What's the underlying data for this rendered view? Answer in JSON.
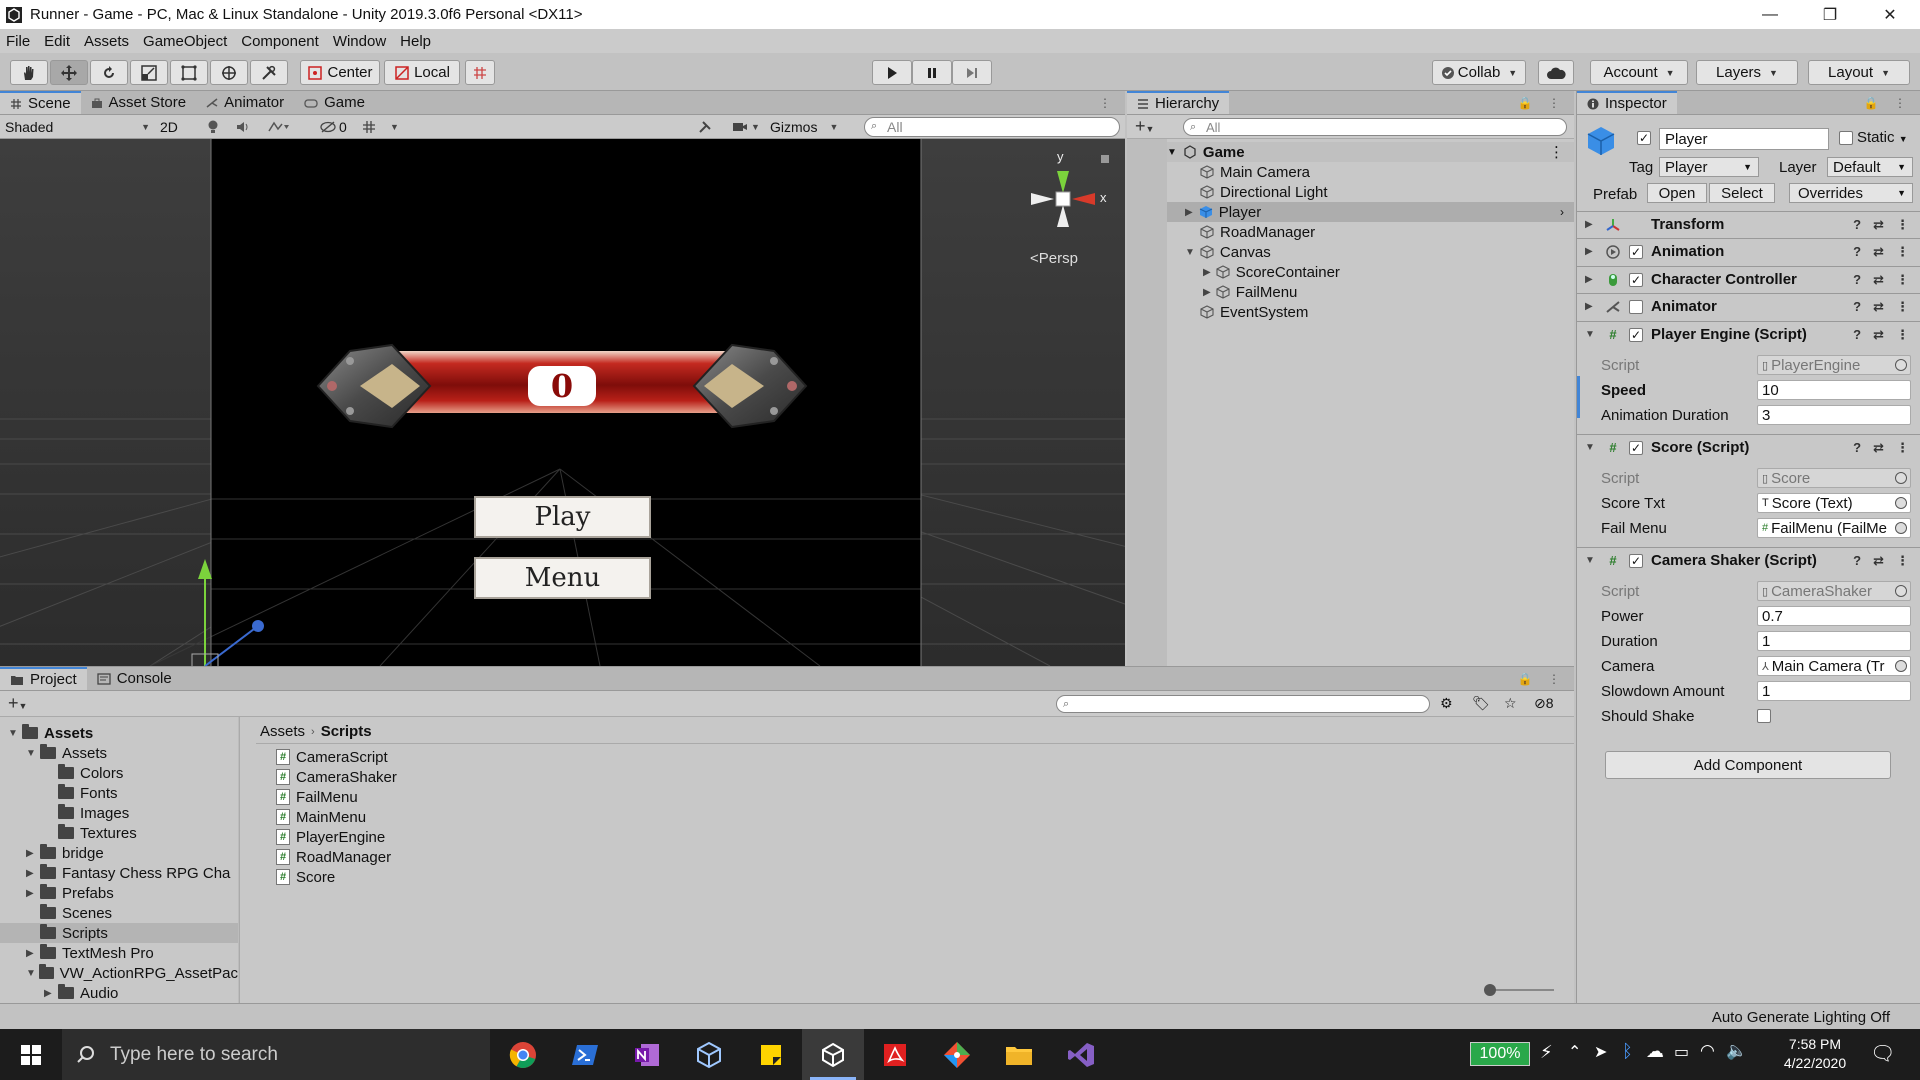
{
  "window": {
    "title": "Runner - Game - PC, Mac & Linux Standalone - Unity 2019.3.0f6 Personal <DX11>",
    "controls": [
      "—",
      "❐",
      "✕"
    ]
  },
  "menu": [
    "File",
    "Edit",
    "Assets",
    "GameObject",
    "Component",
    "Window",
    "Help"
  ],
  "toolbar": {
    "pivot": "Center",
    "space": "Local",
    "collab": "Collab",
    "account": "Account",
    "layers": "Layers",
    "layout": "Layout"
  },
  "scene_panel": {
    "tabs": [
      "Scene",
      "Asset Store",
      "Animator",
      "Game"
    ],
    "shading": "Shaded",
    "mode_2d": "2D",
    "hidden_count": "0",
    "gizmos": "Gizmos",
    "search_placeholder": "All",
    "persp_label": "Persp",
    "axis_y": "y",
    "axis_x": "x",
    "game_ui": {
      "score": "0",
      "play_button": "Play",
      "menu_button": "Menu"
    }
  },
  "hierarchy": {
    "tab": "Hierarchy",
    "search_placeholder": "All",
    "scene_name": "Game",
    "items": [
      "Main Camera",
      "Directional Light",
      "Player",
      "RoadManager",
      "Canvas",
      "ScoreContainer",
      "FailMenu",
      "EventSystem"
    ]
  },
  "inspector": {
    "tab": "Inspector",
    "object_name": "Player",
    "static_label": "Static",
    "tag_label": "Tag",
    "tag_value": "Player",
    "layer_label": "Layer",
    "layer_value": "Default",
    "prefab_label": "Prefab",
    "prefab_open": "Open",
    "prefab_select": "Select",
    "prefab_overrides": "Overrides",
    "components": {
      "transform": "Transform",
      "animation": "Animation",
      "character_controller": "Character Controller",
      "animator": "Animator",
      "player_engine": "Player Engine (Script)",
      "score": "Score (Script)",
      "camera_shaker": "Camera Shaker (Script)"
    },
    "player_engine_props": {
      "script_label": "Script",
      "script_value": "PlayerEngine",
      "speed_label": "Speed",
      "speed_value": "10",
      "anim_label": "Animation Duration",
      "anim_value": "3"
    },
    "score_props": {
      "script_label": "Script",
      "script_value": "Score",
      "scoretxt_label": "Score Txt",
      "scoretxt_value": "Score (Text)",
      "failmenu_label": "Fail Menu",
      "failmenu_value": "FailMenu (FailMe"
    },
    "shaker_props": {
      "script_label": "Script",
      "script_value": "CameraShaker",
      "power_label": "Power",
      "power_value": "0.7",
      "duration_label": "Duration",
      "duration_value": "1",
      "camera_label": "Camera",
      "camera_value": "Main Camera (Tr",
      "slowdown_label": "Slowdown Amount",
      "slowdown_value": "1",
      "shake_label": "Should Shake"
    },
    "add_component": "Add Component"
  },
  "project_panel": {
    "tabs": [
      "Project",
      "Console"
    ],
    "hidden_count": "8",
    "breadcrumb": [
      "Assets",
      "Scripts"
    ],
    "tree": [
      {
        "label": "Assets",
        "depth": 0,
        "arrow": "▼",
        "bold": true
      },
      {
        "label": "Assets",
        "depth": 1,
        "arrow": "▼"
      },
      {
        "label": "Colors",
        "depth": 2,
        "arrow": ""
      },
      {
        "label": "Fonts",
        "depth": 2,
        "arrow": ""
      },
      {
        "label": "Images",
        "depth": 2,
        "arrow": ""
      },
      {
        "label": "Textures",
        "depth": 2,
        "arrow": ""
      },
      {
        "label": "bridge",
        "depth": 1,
        "arrow": "▶"
      },
      {
        "label": "Fantasy Chess RPG Cha",
        "depth": 1,
        "arrow": "▶"
      },
      {
        "label": "Prefabs",
        "depth": 1,
        "arrow": "▶"
      },
      {
        "label": "Scenes",
        "depth": 1,
        "arrow": ""
      },
      {
        "label": "Scripts",
        "depth": 1,
        "arrow": "",
        "selected": true
      },
      {
        "label": "TextMesh Pro",
        "depth": 1,
        "arrow": "▶"
      },
      {
        "label": "VW_ActionRPG_AssetPac",
        "depth": 1,
        "arrow": "▼"
      },
      {
        "label": "Audio",
        "depth": 2,
        "arrow": "▶"
      }
    ],
    "files": [
      "CameraScript",
      "CameraShaker",
      "FailMenu",
      "MainMenu",
      "PlayerEngine",
      "RoadManager",
      "Score"
    ]
  },
  "status": {
    "lighting": "Auto Generate Lighting Off"
  },
  "taskbar": {
    "search_placeholder": "Type here to search",
    "battery": "100%",
    "time": "7:58 PM",
    "date": "4/22/2020"
  },
  "colors": {
    "accent": "#4285d6",
    "panel": "#c8c8c8",
    "viewport": "#3a3a3a",
    "banner_red": "#b01818",
    "taskbar": "#1c1c1c"
  }
}
